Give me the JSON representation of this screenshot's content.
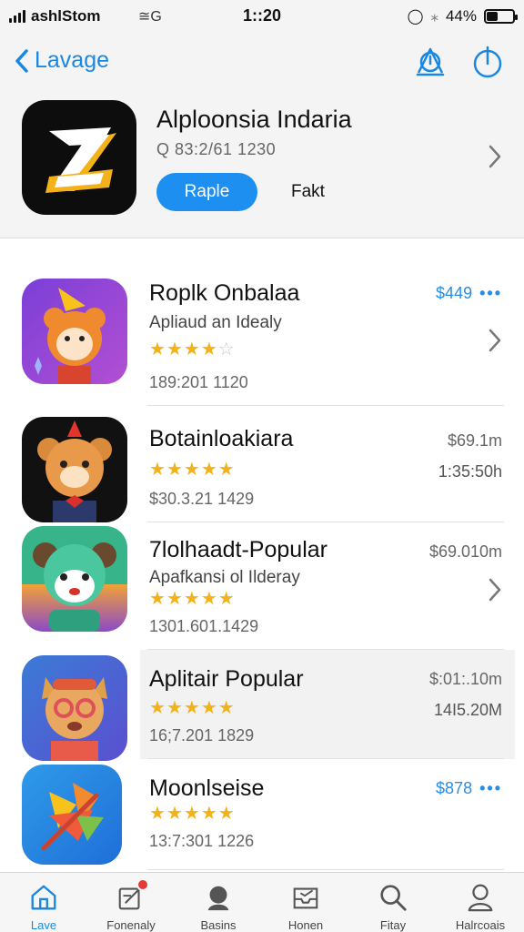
{
  "status_bar": {
    "carrier": "ashlStom",
    "network": "≅G",
    "time": "1::20",
    "battery_percent": "44%",
    "battery_level": 0.44
  },
  "header": {
    "back_label": "Lavage",
    "app_title": "Alploonsia Indaria",
    "app_subtitle": "Q 83:2/61 1230",
    "primary_button": "Raple",
    "secondary_link": "Fakt",
    "icons": [
      "alert-icon",
      "power-icon",
      "chevron-right-icon"
    ]
  },
  "list": [
    {
      "title": "Roplk Onbalaa",
      "subtitle": "Apliaud an Idealy",
      "rating": 3.5,
      "date": "189:201 1120",
      "price": "$449",
      "price_style": "blue",
      "has_more": true,
      "price_secondary": "",
      "has_chevron": true,
      "icon": "orange-creature-app-icon"
    },
    {
      "title": "Botainloakiara",
      "subtitle": "",
      "rating": 4.5,
      "date": "$30.3.21 1429",
      "price": "$69.1m",
      "price_style": "gray",
      "has_more": false,
      "price_secondary": "1:35:50h",
      "has_chevron": false,
      "icon": "bear-app-icon"
    },
    {
      "title": "7lolhaadt-Popular",
      "subtitle": "Apafkansi ol Ilderay",
      "rating": 4.5,
      "date": "1301.601.1429",
      "price": "$69.010m",
      "price_style": "gray",
      "has_more": false,
      "price_secondary": "",
      "has_chevron": true,
      "icon": "green-bear-app-icon"
    },
    {
      "title": "Aplitair Popular",
      "subtitle": "",
      "rating": 5,
      "date": "16;7.201 1829",
      "price": "$:01:.10m",
      "price_style": "gray",
      "has_more": false,
      "price_secondary": "14I5.20M",
      "has_chevron": false,
      "icon": "cat-app-icon"
    },
    {
      "title": "Moonlseise",
      "subtitle": "",
      "rating": 4.5,
      "date": "13:7:301 1226",
      "price": "$878",
      "price_style": "blue",
      "has_more": true,
      "price_secondary": "",
      "has_chevron": false,
      "icon": "leaf-app-icon"
    }
  ],
  "tabbar": [
    {
      "label": "Lave",
      "icon": "home-icon",
      "active": true,
      "badge": false
    },
    {
      "label": "Fonenaly",
      "icon": "edit-icon",
      "active": false,
      "badge": true
    },
    {
      "label": "Basins",
      "icon": "person-icon",
      "active": false,
      "badge": false
    },
    {
      "label": "Honen",
      "icon": "inbox-icon",
      "active": false,
      "badge": false
    },
    {
      "label": "Fitay",
      "icon": "search-icon",
      "active": false,
      "badge": false
    },
    {
      "label": "Halrcoais",
      "icon": "user-icon",
      "active": false,
      "badge": false
    }
  ],
  "colors": {
    "accent": "#1d8ff0",
    "star": "#f3b21a",
    "header_bg": "#f4f4f5"
  }
}
